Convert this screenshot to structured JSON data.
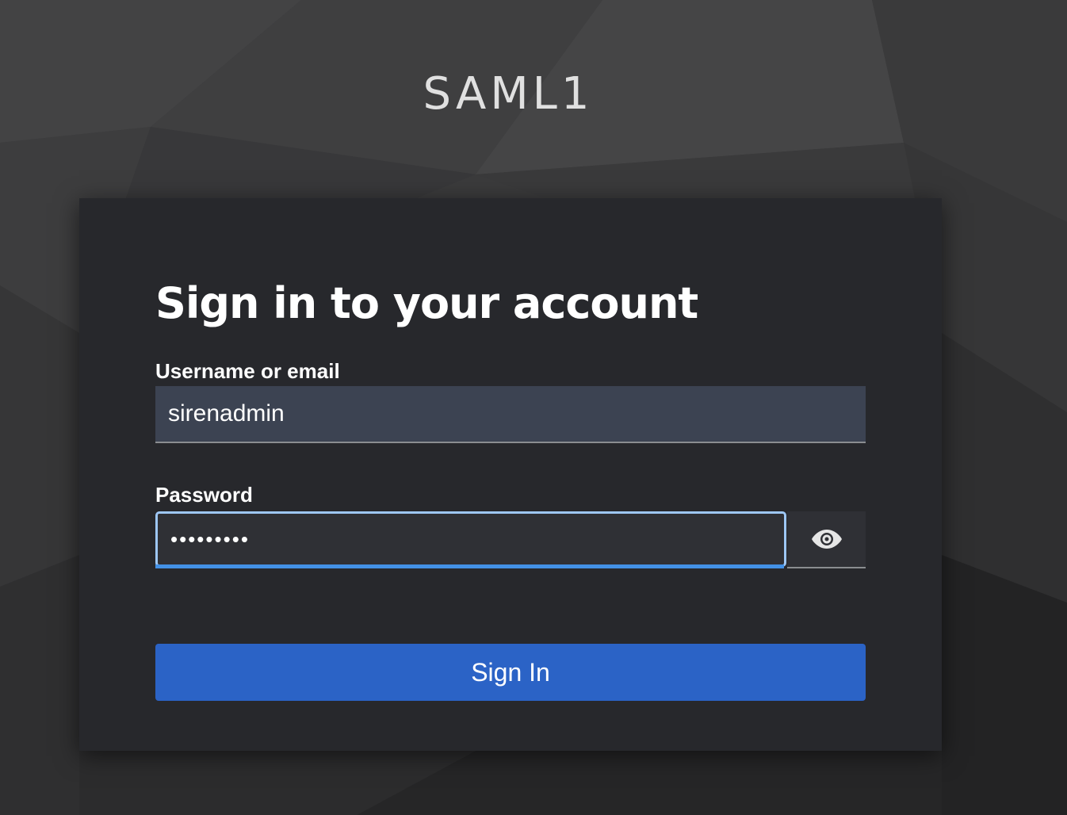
{
  "realm": {
    "title": "SAML1"
  },
  "login": {
    "heading": "Sign in to your account",
    "username": {
      "label": "Username or email",
      "value": "sirenadmin"
    },
    "password": {
      "label": "Password",
      "value": "•••••••••",
      "show_toggle_icon": "eye-icon"
    },
    "submit_label": "Sign In"
  },
  "colors": {
    "card_background": "#27282c",
    "primary_button": "#2b63c6",
    "focus_border": "#9ec7f5",
    "focus_underline": "#4391e6"
  }
}
